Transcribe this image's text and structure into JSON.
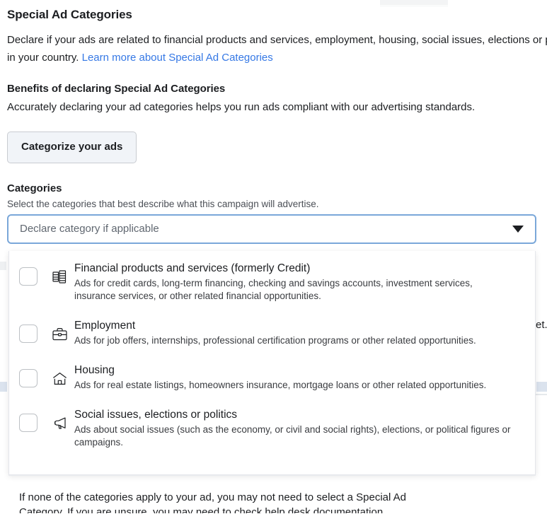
{
  "page": {
    "section_title": "Special Ad Categories",
    "intro_text": "Declare if your ads are related to financial products and services, employment, housing, social issues, elections or politics in your country. ",
    "intro_link": "Learn more about Special Ad Categories",
    "benefits_title": "Benefits of declaring Special Ad Categories",
    "benefits_text": "Accurately declaring your ad categories helps you run ads compliant with our advertising standards.",
    "categorize_button": "Categorize your ads",
    "categories_title": "Categories",
    "categories_help": "Select the categories that best describe what this campaign will advertise."
  },
  "select": {
    "placeholder": "Declare category if applicable",
    "value": "",
    "caret_icon": "chevron-down-icon",
    "focus_color": "#7aa7d9"
  },
  "dropdown": {
    "options": [
      {
        "icon": "money-stack-icon",
        "title": "Financial products and services (formerly Credit)",
        "description": "Ads for credit cards, long-term financing, checking and savings accounts, investment services, insurance services, or other related financial opportunities.",
        "checked": false
      },
      {
        "icon": "briefcase-icon",
        "title": "Employment",
        "description": "Ads for job offers, internships, professional certification programs or other related opportunities.",
        "checked": false
      },
      {
        "icon": "house-icon",
        "title": "Housing",
        "description": "Ads for real estate listings, homeowners insurance, mortgage loans or other related opportunities.",
        "checked": false
      },
      {
        "icon": "megaphone-icon",
        "title": "Social issues, elections or politics",
        "description": "Ads about social issues (such as the economy, or civil and social rights), elections, or political figures or campaigns.",
        "checked": false
      }
    ],
    "footer_line1": "If none of the categories apply to your ad, you may not need to select a Special Ad",
    "footer_line2": "Category. If you are unsure, you may need to check help desk documentation."
  },
  "background": {
    "right_clipped_text": "et.",
    "accent_color": "#dbe3ee"
  }
}
